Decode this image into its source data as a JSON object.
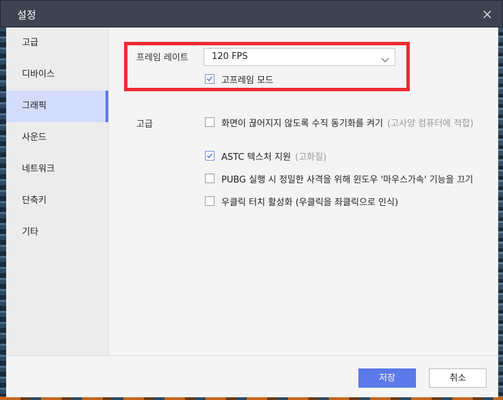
{
  "window": {
    "title": "설정"
  },
  "sidebar": {
    "items": [
      {
        "label": "고급",
        "active": false
      },
      {
        "label": "디바이스",
        "active": false
      },
      {
        "label": "그래픽",
        "active": true
      },
      {
        "label": "사운드",
        "active": false
      },
      {
        "label": "네트워크",
        "active": false
      },
      {
        "label": "단축키",
        "active": false
      },
      {
        "label": "기타",
        "active": false
      }
    ]
  },
  "frame_rate": {
    "label": "프레임 레이트",
    "selected_value": "120 FPS",
    "high_frame_mode_label": "고프레임 모드",
    "high_frame_mode_checked": true
  },
  "advanced": {
    "label": "고급",
    "options": [
      {
        "label": "화면이 끊어지지 않도록 수직 동기화를 켜기",
        "hint": "(고사양 컴퓨터에 적합)",
        "checked": false
      },
      {
        "label": "ASTC 텍스처 지원",
        "hint": "(고화질)",
        "checked": true
      },
      {
        "label": "PUBG 실행 시 정밀한 사격을 위해 윈도우 '마우스가속' 기능을 끄기",
        "hint": "",
        "checked": false
      },
      {
        "label": "우클릭 터치 활성화 (우클릭을 좌클릭으로 인식)",
        "hint": "",
        "checked": false
      }
    ]
  },
  "footer": {
    "save_label": "저장",
    "cancel_label": "취소"
  },
  "colors": {
    "accent": "#5b79e8",
    "highlight_border": "#ee2a34",
    "titlebar": "#3d4350"
  }
}
